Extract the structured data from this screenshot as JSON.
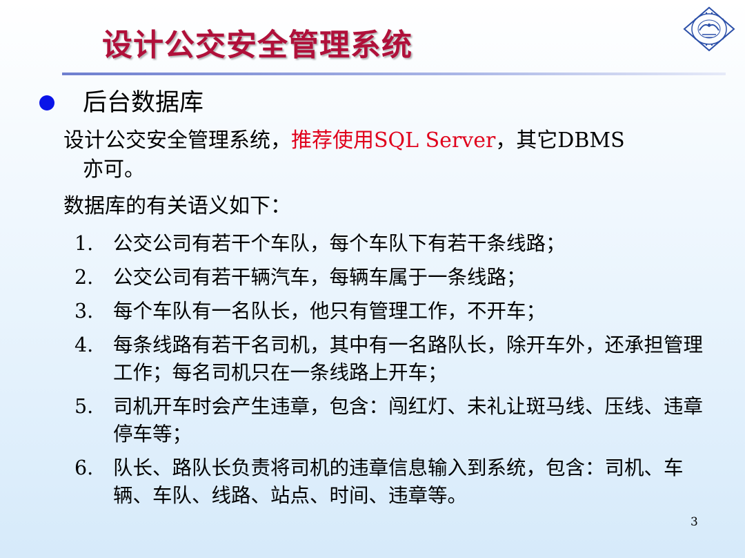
{
  "slide": {
    "title": "设计公交安全管理系统",
    "heading": "后台数据库",
    "intro_part1": "设计公交安全管理系统，",
    "intro_highlight": "推荐使用SQL Server",
    "intro_part2": "，其它DBMS",
    "intro_line2": "亦可。",
    "semantics_label": "数据库的有关语义如下：",
    "items": [
      {
        "num": "1.",
        "text": "公交公司有若干个车队，每个车队下有若干条线路；"
      },
      {
        "num": "2.",
        "text": "公交公司有若干辆汽车，每辆车属于一条线路；"
      },
      {
        "num": "3.",
        "text": "每个车队有一名队长，他只有管理工作，不开车；"
      },
      {
        "num": "4.",
        "text": "每条线路有若干名司机，其中有一名路队长，除开车外，还承担管理工作；每名司机只在一条线路上开车；"
      },
      {
        "num": "5.",
        "text": "司机开车时会产生违章，包含：闯红灯、未礼让斑马线、压线、违章停车等；"
      },
      {
        "num": "6.",
        "text": "队长、路队长负责将司机的违章信息输入到系统，包含：司机、车辆、车队、线路、站点、时间、违章等。"
      }
    ],
    "page_number": "3"
  },
  "colors": {
    "title": "#b0103a",
    "highlight": "#e0001b",
    "bullet": "#0a14e8",
    "rule": "#6f7fcf",
    "logo": "#2b4fa8"
  },
  "icons": {
    "logo": "university-seal-icon",
    "bullet": "bullet-dot-icon"
  }
}
